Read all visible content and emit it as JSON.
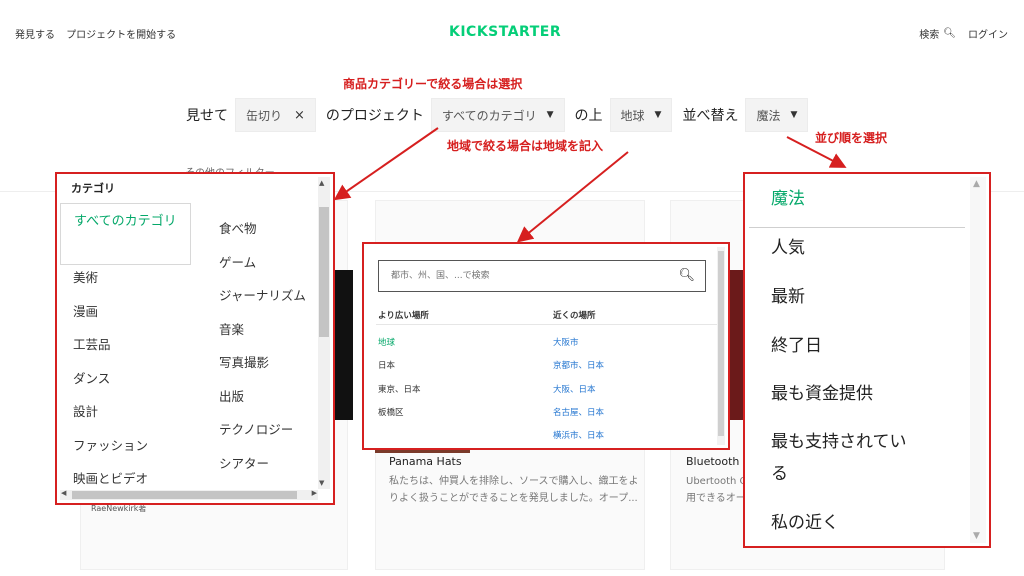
{
  "header": {
    "discover": "発見する",
    "start_project": "プロジェクトを開始する",
    "logo": "KICKSTARTER",
    "search": "検索",
    "login": "ログイン"
  },
  "filter_row": {
    "show": "見せて",
    "keyword": "缶切り",
    "projects_of": "のプロジェクト",
    "category": "すべてのカテゴリ",
    "on": "の上",
    "location": "地球",
    "sort_label": "並べ替え",
    "sort": "魔法",
    "other_filters": "その他のフィルター"
  },
  "annotations": {
    "category_note": "商品カテゴリーで絞る場合は選択",
    "location_note": "地域で絞る場合は地域を記入",
    "sort_note": "並び順を選択"
  },
  "category_panel": {
    "title": "カテゴリ",
    "selected": "すべてのカテゴリ",
    "left_items": [
      "美術",
      "漫画",
      "工芸品",
      "ダンス",
      "設計",
      "ファッション",
      "映画とビデオ"
    ],
    "right_items": [
      "食べ物",
      "ゲーム",
      "ジャーナリズム",
      "音楽",
      "写真撮影",
      "出版",
      "テクノロジー",
      "シアター"
    ]
  },
  "location_panel": {
    "placeholder": "都市、州、国、...で検索",
    "broad_header": "より広い場所",
    "near_header": "近くの場所",
    "broad_items": [
      "地球",
      "日本",
      "東京、日本",
      "板橋区"
    ],
    "near_items": [
      "大阪市",
      "京都市、日本",
      "大阪、日本",
      "名古屋、日本",
      "横浜市、日本"
    ]
  },
  "sort_panel": {
    "items": [
      "魔法",
      "人気",
      "最新",
      "終了日",
      "最も資金提供",
      "最も支持されてい",
      "る",
      "私の近く"
    ]
  },
  "cards": {
    "card2_title": "Panama Hats",
    "card2_desc1": "私たちは、仲買人を排除し、ソースで購入し、織工をよ",
    "card2_desc2": "りよく扱うことができることを発見しました。オープ...",
    "card3_title": "Bluetooth",
    "card3_desc1": "Ubertooth O",
    "card3_desc2": "用できるオー",
    "card1_creator": "RaeNewkirk著"
  },
  "colors": {
    "brand": "#05ce78",
    "annotation": "#d61f1f",
    "selected": "#05a86a",
    "link": "#2476d0"
  }
}
